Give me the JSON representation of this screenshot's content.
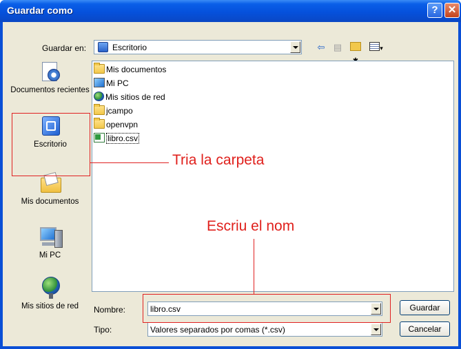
{
  "window": {
    "title": "Guardar como"
  },
  "toolbar": {
    "save_in_label": "Guardar en:",
    "save_in_value": "Escritorio",
    "icons": [
      "desktop-icon",
      "back-arrow-icon",
      "up-folder-icon",
      "new-folder-icon",
      "view-menu-icon"
    ]
  },
  "places": [
    {
      "label": "Documentos recientes",
      "icon": "recent-documents-icon"
    },
    {
      "label": "Escritorio",
      "icon": "desktop-icon"
    },
    {
      "label": "Mis documentos",
      "icon": "my-documents-icon"
    },
    {
      "label": "Mi PC",
      "icon": "my-computer-icon"
    },
    {
      "label": "Mis sitios de red",
      "icon": "network-places-icon"
    }
  ],
  "files": [
    {
      "name": "Mis documentos",
      "icon": "folder-icon"
    },
    {
      "name": "Mi PC",
      "icon": "computer-icon"
    },
    {
      "name": "Mis sitios de red",
      "icon": "network-icon"
    },
    {
      "name": "jcampo",
      "icon": "folder-icon"
    },
    {
      "name": "openvpn",
      "icon": "folder-icon"
    },
    {
      "name": "libro.csv",
      "icon": "excel-file-icon"
    }
  ],
  "form": {
    "name_label": "Nombre:",
    "name_value": "libro.csv",
    "type_label": "Tipo:",
    "type_value": "Valores separados por comas (*.csv)"
  },
  "buttons": {
    "save": "Guardar",
    "cancel": "Cancelar"
  },
  "annotations": {
    "folder": "Tria la carpeta",
    "name": "Escriu el nom"
  },
  "colors": {
    "title_bar": "#0551dc",
    "annotation": "#e0201c",
    "dialog_bg": "#ece9d8"
  }
}
